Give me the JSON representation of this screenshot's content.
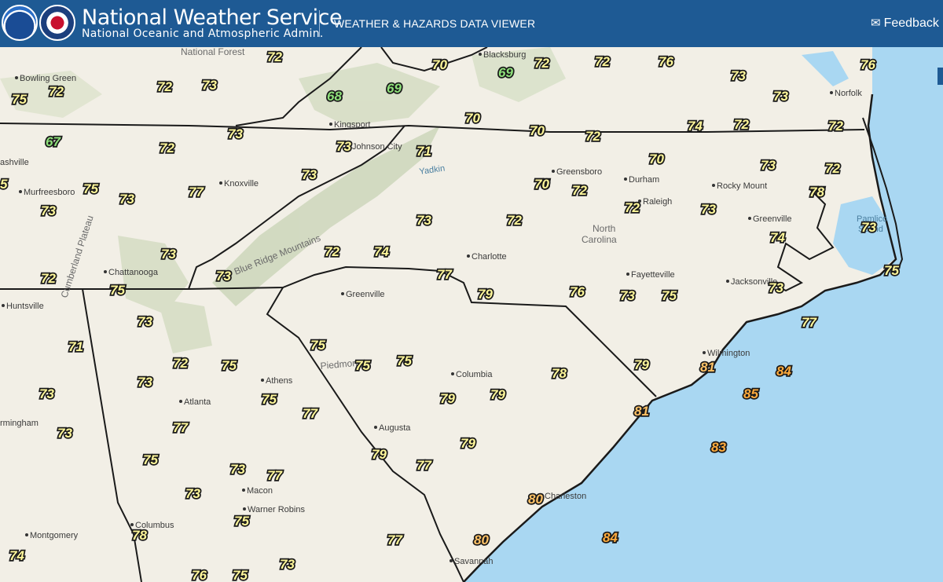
{
  "header": {
    "agency_title": "National Weather Service",
    "agency_subtitle": "National Oceanic and Atmospheric Admin.",
    "viewer_title": "WEATHER & HAZARDS DATA VIEWER",
    "feedback_label": "Feedback",
    "feedback_icon": "envelope-icon",
    "logos": [
      "noaa-logo",
      "nws-logo"
    ],
    "background_color": "#1e5a94"
  },
  "map": {
    "land_color": "#f2efe6",
    "water_color": "#a9d7f2",
    "mountain_color": "#b9c9a4",
    "state_border_color": "#1a1a1a",
    "temp_colors": {
      "cool": "#8ee07a",
      "mild": "#fff79a",
      "warm": "#ffc266",
      "hot": "#ffab3d"
    },
    "cities": [
      "Bowling Green",
      "ashville",
      "Murfreesboro",
      "Knoxville",
      "Kingsport",
      "Johnson City",
      "Blacksburg",
      "Greensboro",
      "Durham",
      "Raleigh",
      "Rocky Mount",
      "Greenville",
      "Norfolk",
      "Charlotte",
      "Fayetteville",
      "Jacksonville",
      "Wilmington",
      "Chattanooga",
      "Huntsville",
      "Greenville",
      "Columbia",
      "Athens",
      "Atlanta",
      "Augusta",
      "rmingham",
      "Charleston",
      "Macon",
      "Warner Robins",
      "Columbus",
      "Montgomery",
      "Savannah"
    ],
    "regions": [
      "National Forest",
      "Yadkin",
      "North Carolina",
      "Pamlico Sound",
      "Blue Ridge Mountains",
      "Cumberland Plateau",
      "Piedmont"
    ],
    "temperatures": [
      "72",
      "70",
      "72",
      "72",
      "76",
      "76",
      "75",
      "72",
      "72",
      "73",
      "69",
      "69",
      "73",
      "73",
      "68",
      "70",
      "70",
      "74",
      "72",
      "72",
      "67",
      "72",
      "73",
      "73",
      "71",
      "70",
      "73",
      "72",
      "5",
      "75",
      "73",
      "77",
      "73",
      "73",
      "72",
      "75",
      "72",
      "72",
      "73",
      "73",
      "75",
      "73",
      "78",
      "70",
      "73",
      "72",
      "74",
      "74",
      "73",
      "72",
      "75",
      "72",
      "73",
      "77",
      "79",
      "76",
      "73",
      "75",
      "77",
      "75",
      "75",
      "79",
      "81",
      "71",
      "73",
      "72",
      "75",
      "73",
      "79",
      "79",
      "78",
      "75",
      "84",
      "73",
      "77",
      "81",
      "85",
      "73",
      "77",
      "77",
      "83",
      "75",
      "75",
      "79",
      "79",
      "75",
      "73",
      "77",
      "80",
      "75",
      "73",
      "78",
      "77",
      "80",
      "84",
      "74",
      "76",
      "75",
      "73"
    ]
  }
}
